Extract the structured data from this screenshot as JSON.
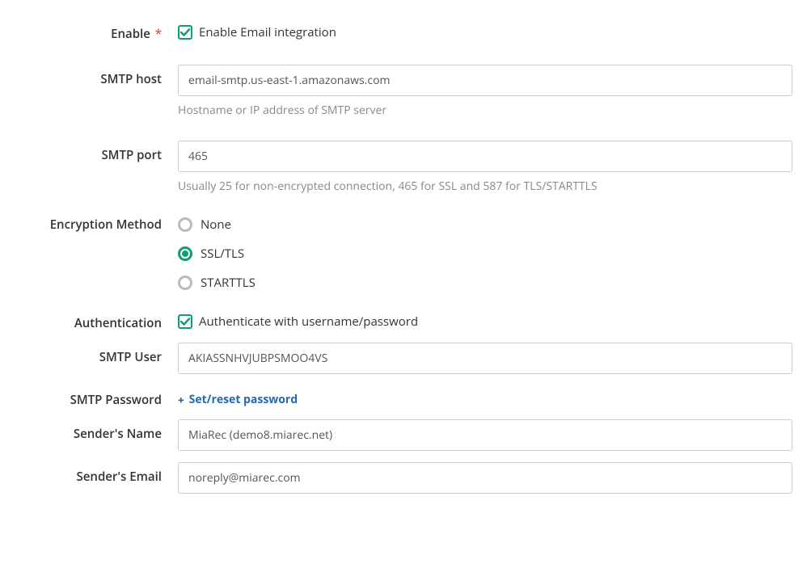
{
  "fields": {
    "enable": {
      "label": "Enable",
      "required_marker": "*",
      "checkbox_label": "Enable Email integration"
    },
    "smtp_host": {
      "label": "SMTP host",
      "value": "email-smtp.us-east-1.amazonaws.com",
      "help": "Hostname or IP address of SMTP server"
    },
    "smtp_port": {
      "label": "SMTP port",
      "value": "465",
      "help": "Usually 25 for non-encrypted connection, 465 for SSL and 587 for TLS/STARTTLS"
    },
    "encryption": {
      "label": "Encryption Method",
      "options": {
        "none": "None",
        "ssl": "SSL/TLS",
        "starttls": "STARTTLS"
      }
    },
    "authentication": {
      "label": "Authentication",
      "checkbox_label": "Authenticate with username/password"
    },
    "smtp_user": {
      "label": "SMTP User",
      "value": "AKIASSNHVJUBPSMOO4VS"
    },
    "smtp_password": {
      "label": "SMTP Password",
      "action_label": "Set/reset password"
    },
    "sender_name": {
      "label": "Sender's Name",
      "value": "MiaRec (demo8.miarec.net)"
    },
    "sender_email": {
      "label": "Sender's Email",
      "value": "noreply@miarec.com"
    }
  },
  "colors": {
    "accent": "#0e9d79",
    "link": "#2869b3"
  }
}
